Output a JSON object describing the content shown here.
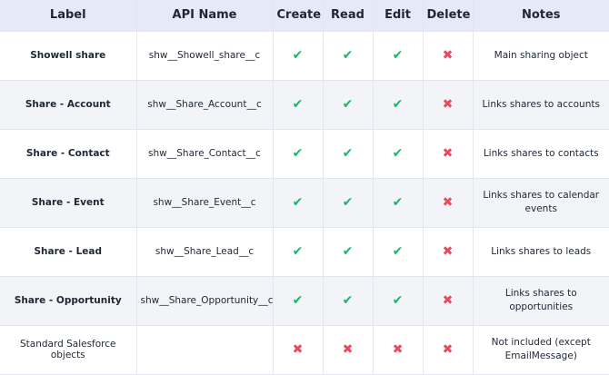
{
  "columns": [
    "Label",
    "API Name",
    "Create",
    "Read",
    "Edit",
    "Delete",
    "Notes"
  ],
  "colors": {
    "allowed": "#1db56b",
    "denied": "#e84b5e",
    "header_bg": "#e6eaf8",
    "stripe_bg": "#f3f4f7"
  },
  "rows": [
    {
      "label": "Showell share",
      "api": "shw__Showell_share__c",
      "create": true,
      "read": true,
      "edit": true,
      "delete": false,
      "notes": "Main sharing object",
      "bold": true
    },
    {
      "label": "Share - Account",
      "api": "shw__Share_Account__c",
      "create": true,
      "read": true,
      "edit": true,
      "delete": false,
      "notes": "Links shares to accounts",
      "bold": true
    },
    {
      "label": "Share - Contact",
      "api": "shw__Share_Contact__c",
      "create": true,
      "read": true,
      "edit": true,
      "delete": false,
      "notes": "Links shares to contacts",
      "bold": true
    },
    {
      "label": "Share - Event",
      "api": "shw__Share_Event__c",
      "create": true,
      "read": true,
      "edit": true,
      "delete": false,
      "notes": "Links shares to calendar events",
      "bold": true
    },
    {
      "label": "Share - Lead",
      "api": "shw__Share_Lead__c",
      "create": true,
      "read": true,
      "edit": true,
      "delete": false,
      "notes": "Links shares to leads",
      "bold": true
    },
    {
      "label": "Share - Opportunity",
      "api": "shw__Share_Opportunity__c",
      "create": true,
      "read": true,
      "edit": true,
      "delete": false,
      "notes": "Links shares to opportunities",
      "bold": true
    },
    {
      "label": "Standard Salesforce objects",
      "api": "",
      "create": false,
      "read": false,
      "edit": false,
      "delete": false,
      "notes": "Not included (except EmailMessage)",
      "bold": false
    }
  ]
}
